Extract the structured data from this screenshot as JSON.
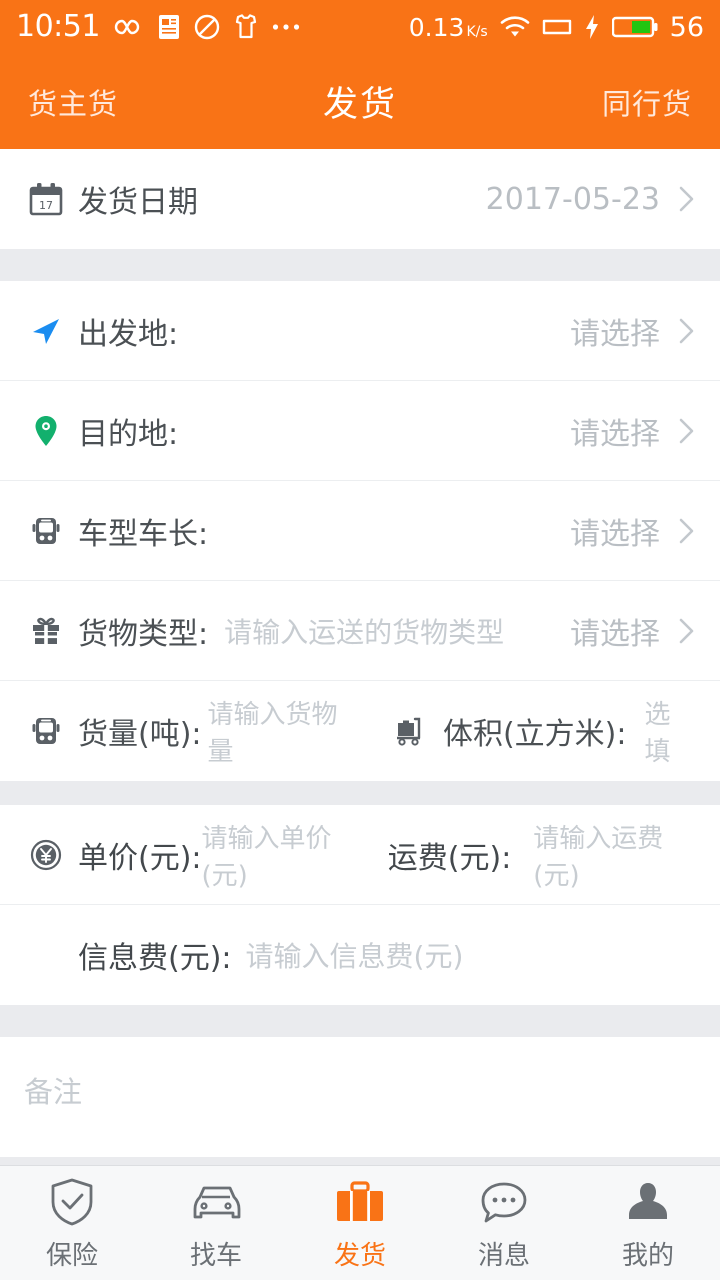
{
  "theme": {
    "accent": "#f97316",
    "divider": "#eceef0",
    "band": "#eaebee",
    "placeholder": "#c7ccd1"
  },
  "status_bar": {
    "time": "10:51",
    "icons_left": [
      "infinity-icon",
      "document-icon",
      "no-entry-icon",
      "shirt-icon",
      "more-dots-icon"
    ],
    "network_speed": "0.13",
    "network_unit": "K/s",
    "icons_right": [
      "wifi-icon",
      "sim-card-icon",
      "charging-bolt-icon"
    ],
    "battery_percent": "56"
  },
  "title_bar": {
    "left_tab": "货主货",
    "title": "发货",
    "right_tab": "同行货"
  },
  "form": {
    "date_row": {
      "icon": "calendar-icon",
      "calendar_day": "17",
      "label": "发货日期",
      "value": "2017-05-23",
      "chevron": "chevron-right-icon"
    },
    "origin_row": {
      "icon": "navigation-arrow-icon",
      "label": "出发地:",
      "value": "请选择",
      "chevron": "chevron-right-icon"
    },
    "destination_row": {
      "icon": "map-pin-icon",
      "label": "目的地:",
      "value": "请选择",
      "chevron": "chevron-right-icon"
    },
    "vehicle_row": {
      "icon": "bus-front-icon",
      "label": "车型车长:",
      "value": "请选择",
      "chevron": "chevron-right-icon"
    },
    "cargo_type_row": {
      "icon": "gift-box-icon",
      "label": "货物类型:",
      "placeholder": "请输入运送的货物类型",
      "value": "请选择",
      "chevron": "chevron-right-icon"
    },
    "weight_volume_row": {
      "weight_icon": "bus-front-icon",
      "weight_label": "货量(吨):",
      "weight_placeholder": "请输入货物量",
      "volume_icon": "luggage-cart-icon",
      "volume_label": "体积(立方米):",
      "volume_placeholder": "选填"
    },
    "price_row": {
      "icon": "yuan-coin-icon",
      "unit_price_label": "单价(元):",
      "unit_price_placeholder": "请输入单价(元)",
      "freight_label": "运费(元):",
      "freight_placeholder": "请输入运费(元)"
    },
    "info_fee_row": {
      "label": "信息费(元):",
      "placeholder": "请输入信息费(元)"
    },
    "remark": {
      "placeholder": "备注"
    }
  },
  "tab_bar": {
    "items": [
      {
        "label": "保险",
        "icon": "shield-check-icon",
        "active": false
      },
      {
        "label": "找车",
        "icon": "car-icon",
        "active": false
      },
      {
        "label": "发货",
        "icon": "briefcase-icon",
        "active": true
      },
      {
        "label": "消息",
        "icon": "chat-bubble-icon",
        "active": false
      },
      {
        "label": "我的",
        "icon": "person-icon",
        "active": false
      }
    ]
  }
}
